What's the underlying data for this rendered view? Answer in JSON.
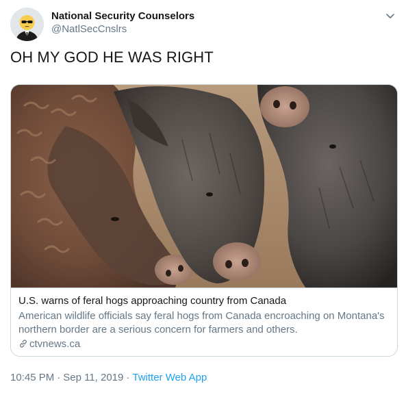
{
  "author": {
    "display_name": "National Security Counselors",
    "handle": "@NatlSecCnslrs"
  },
  "tweet": {
    "text": "OH MY GOD HE WAS RIGHT"
  },
  "card": {
    "title": "U.S. warns of feral hogs approaching country from Canada",
    "description": "American wildlife officials say feral hogs from Canada encroaching on Montana's northern border are a serious concern for farmers and others.",
    "domain": "ctvnews.ca"
  },
  "meta": {
    "time": "10:45 PM",
    "separator": "·",
    "date": "Sep 11, 2019",
    "source": "Twitter Web App"
  },
  "colors": {
    "text": "#14171a",
    "secondary": "#657786",
    "link": "#1da1f2",
    "border": "#ccd6dd"
  },
  "icons": [
    "avatar-emoji",
    "chevron-down-icon",
    "link-icon"
  ]
}
